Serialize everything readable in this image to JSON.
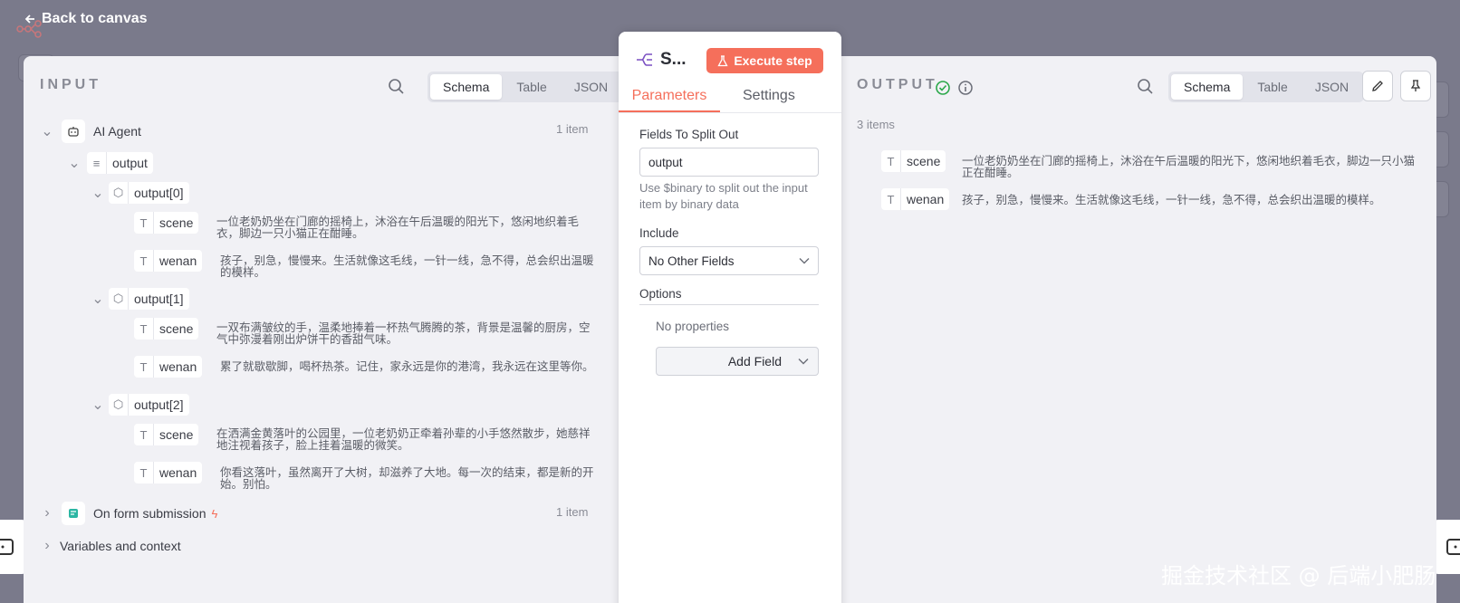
{
  "nav": {
    "back_label": "Back to canvas"
  },
  "input_panel": {
    "title": "INPUT",
    "view_tabs": [
      "Schema",
      "Table",
      "JSON"
    ],
    "active_view": "Schema",
    "nodes": [
      {
        "label": "AI Agent",
        "count": "1 item",
        "field": "output",
        "entries": [
          {
            "label": "output[0]",
            "scene": "一位老奶奶坐在门廊的摇椅上，沐浴在午后温暖的阳光下，悠闲地织着毛衣，脚边一只小猫正在酣睡。",
            "wenan": "孩子，别急，慢慢来。生活就像这毛线，一针一线，急不得，总会织出温暖的模样。"
          },
          {
            "label": "output[1]",
            "scene": "一双布满皱纹的手，温柔地捧着一杯热气腾腾的茶，背景是温馨的厨房，空气中弥漫着刚出炉饼干的香甜气味。",
            "wenan": "累了就歇歇脚，喝杯热茶。记住，家永远是你的港湾，我永远在这里等你。"
          },
          {
            "label": "output[2]",
            "scene": "在洒满金黄落叶的公园里，一位老奶奶正牵着孙辈的小手悠然散步，她慈祥地注视着孩子，脸上挂着温暖的微笑。",
            "wenan": "你看这落叶，虽然离开了大树，却滋养了大地。每一次的结束，都是新的开始。别怕。"
          }
        ],
        "key_scene": "scene",
        "key_wenan": "wenan"
      },
      {
        "label": "On form submission",
        "count": "1 item"
      },
      {
        "label": "Variables and context"
      }
    ]
  },
  "node_panel": {
    "title": "S...",
    "execute_label": "Execute step",
    "tabs": [
      "Parameters",
      "Settings"
    ],
    "fields_label": "Fields To Split Out",
    "fields_value": "output",
    "fields_hint": "Use $binary to split out the input item by binary data",
    "include_label": "Include",
    "include_value": "No Other Fields",
    "options_label": "Options",
    "no_properties": "No properties",
    "add_field_label": "Add Field"
  },
  "output_panel": {
    "title": "OUTPUT",
    "view_tabs": [
      "Schema",
      "Table",
      "JSON"
    ],
    "active_view": "Schema",
    "count": "3 items",
    "fields": [
      {
        "key": "scene",
        "value": "一位老奶奶坐在门廊的摇椅上，沐浴在午后温暖的阳光下，悠闲地织着毛衣，脚边一只小猫正在酣睡。"
      },
      {
        "key": "wenan",
        "value": "孩子，别急，慢慢来。生活就像这毛线，一针一线，急不得，总会织出温暖的模样。"
      }
    ]
  },
  "watermark": "掘金技术社区 @ 后端小肥肠",
  "colors": {
    "accent": "#f56f5b",
    "success": "#2ba84a",
    "backdrop": "#7a7a8b"
  }
}
